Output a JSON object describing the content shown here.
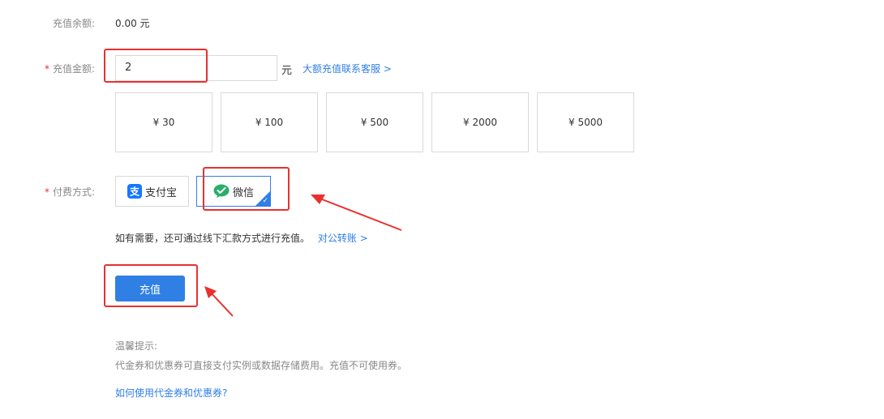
{
  "balance": {
    "label": "充值余额:",
    "value": "0.00 元"
  },
  "amount": {
    "required_mark": "*",
    "label": "充值金额:",
    "input_value": "2",
    "unit": "元",
    "large_amount_link": "大额充值联系客服 >",
    "presets": [
      "¥ 30",
      "¥ 100",
      "¥ 500",
      "¥ 2000",
      "¥ 5000"
    ]
  },
  "payment": {
    "required_mark": "*",
    "label": "付费方式:",
    "alipay_label": "支付宝",
    "wechat_label": "微信",
    "selected": "wechat",
    "offline_text": "如有需要，还可通过线下汇款方式进行充值。",
    "offline_link": "对公转账 >"
  },
  "submit_label": "充值",
  "tips": {
    "title": "温馨提示:",
    "text": "代金券和优惠券可直接支付实例或数据存储费用。充值不可使用券。",
    "link": "如何使用代金券和优惠券?"
  },
  "colors": {
    "accent": "#2f7fe5",
    "annotation": "#e8312f",
    "wechat": "#2aae67",
    "alipay": "#1677ff"
  },
  "icons": {
    "alipay": "alipay-icon",
    "wechat": "wechat-icon",
    "check": "check-icon"
  }
}
